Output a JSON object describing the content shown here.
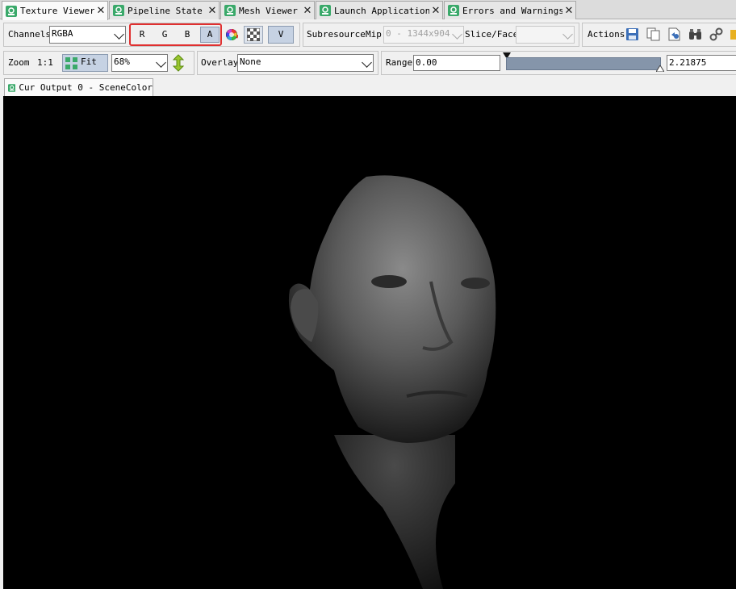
{
  "tabs": [
    {
      "label": "Texture Viewer",
      "active": true
    },
    {
      "label": "Pipeline State",
      "active": false
    },
    {
      "label": "Mesh Viewer",
      "active": false
    },
    {
      "label": "Launch Application",
      "active": false
    },
    {
      "label": "Errors and Warnings",
      "active": false
    }
  ],
  "toolbar1": {
    "channels_label": "Channels",
    "channels_value": "RGBA",
    "channel_buttons": [
      "R",
      "G",
      "B",
      "A"
    ],
    "selected_channel": "A",
    "v_button": "V",
    "subresource_label": "Subresource",
    "mip_label": "Mip",
    "mip_value": "0 - 1344x904",
    "slice_label": "Slice/Face",
    "slice_value": "",
    "actions_label": "Actions"
  },
  "toolbar2": {
    "zoom_label": "Zoom",
    "one_to_one": "1:1",
    "fit_label": "Fit",
    "zoom_value": "68%",
    "overlay_label": "Overlay",
    "overlay_value": "None",
    "range_label": "Range",
    "range_min": "0.00",
    "range_max": "2.21875"
  },
  "viewer": {
    "tab_label": "Cur Output 0 - SceneColor"
  },
  "colors": {
    "tab_icon": "#3aa96a",
    "highlight": "#e03030",
    "range_bar": "#8595aa",
    "canvas": "#000000"
  }
}
